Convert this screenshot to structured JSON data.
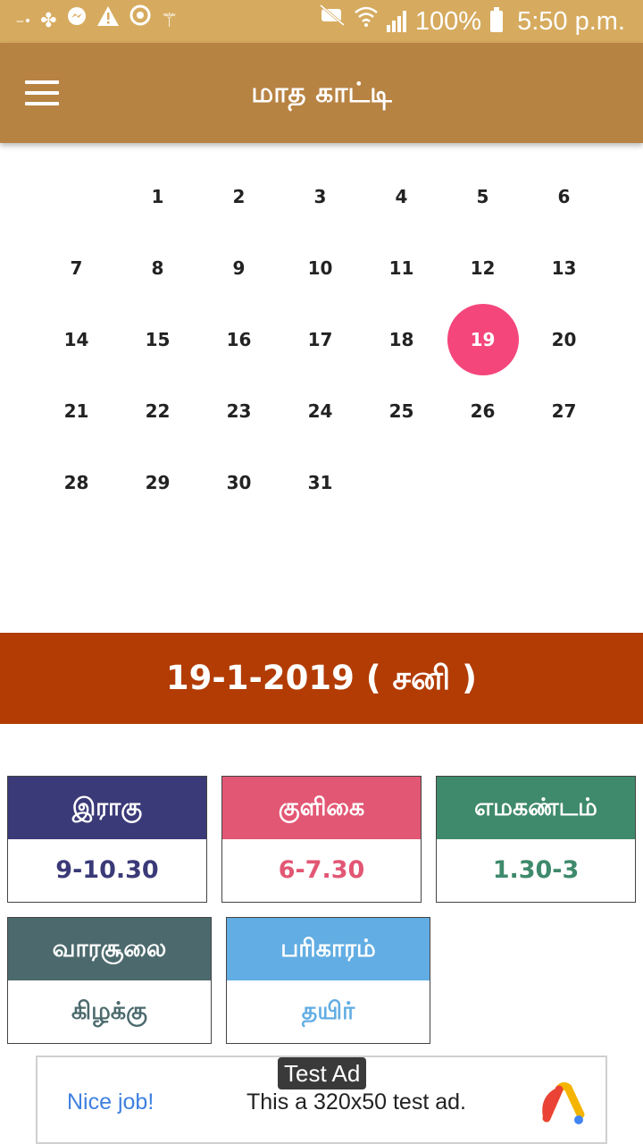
{
  "status_bar": {
    "battery_text": "100%",
    "time": "5:50 p.m.",
    "left_icons": [
      "notification-icon",
      "clover-icon",
      "messenger-icon",
      "warning-icon",
      "sync-icon",
      "magic-wand-icon"
    ],
    "right_icons": [
      "mute-icon",
      "wifi-icon",
      "signal-icon",
      "battery-icon"
    ]
  },
  "app_bar": {
    "title": "மாத காட்டி"
  },
  "calendar": {
    "weeks": [
      [
        "",
        "1",
        "2",
        "3",
        "4",
        "5",
        "6"
      ],
      [
        "7",
        "8",
        "9",
        "10",
        "11",
        "12",
        "13"
      ],
      [
        "14",
        "15",
        "16",
        "17",
        "18",
        "19",
        "20"
      ],
      [
        "21",
        "22",
        "23",
        "24",
        "25",
        "26",
        "27"
      ],
      [
        "28",
        "29",
        "30",
        "31",
        "",
        "",
        ""
      ]
    ],
    "selected_day": "19",
    "selected_color": "#f4467b"
  },
  "selected_date": {
    "label": "19-1-2019 ( சனி )",
    "banner_color": "#b23c04"
  },
  "cards": [
    {
      "title": "இராகு",
      "value": "9-10.30",
      "head_color": "#3b3a78",
      "value_color": "#3b3a78"
    },
    {
      "title": "குளிகை",
      "value": "6-7.30",
      "head_color": "#e25774",
      "value_color": "#e25774"
    },
    {
      "title": "எமகண்டம்",
      "value": "1.30-3",
      "head_color": "#3f8a6c",
      "value_color": "#3f8a6c"
    },
    {
      "title": "வாரசூலை",
      "value": "கிழக்கு",
      "head_color": "#4c6a6d",
      "value_color": "#4c6a6d"
    },
    {
      "title": "பரிகாரம்",
      "value": "தயிர்",
      "head_color": "#62ade3",
      "value_color": "#62ade3"
    }
  ],
  "ad": {
    "tag": "Test Ad",
    "left_text": "Nice job!",
    "center_text": "This a 320x50 test ad."
  }
}
